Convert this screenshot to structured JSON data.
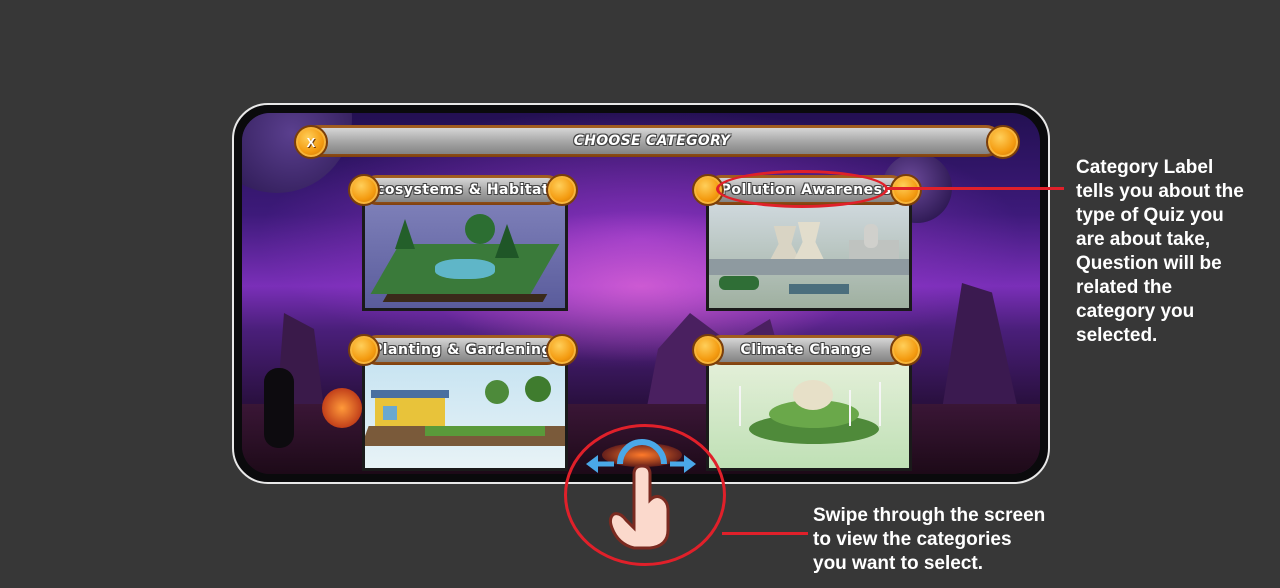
{
  "title_bar": {
    "close_label": "X",
    "title": "CHOOSE CATEGORY"
  },
  "categories": [
    {
      "label": "Ecosystems & Habitats",
      "image_icon": "ecosystem-diorama"
    },
    {
      "label": "Pollution Awareness",
      "image_icon": "power-plant-diorama"
    },
    {
      "label": "Planting & Gardening",
      "image_icon": "garden-house-diorama"
    },
    {
      "label": "Climate Change",
      "image_icon": "wind-turbine-island"
    }
  ],
  "annotations": {
    "category_label_note": [
      "Category Label",
      "tells you about the",
      "type of Quiz you",
      "are about take,",
      "Question will be",
      "related the",
      "category you",
      "selected."
    ],
    "swipe_note": [
      "Swipe through the screen",
      "to view the categories",
      "you want to select."
    ]
  },
  "colors": {
    "accent": "#f49b10",
    "annotation": "#e0202a",
    "background": "#373737"
  }
}
